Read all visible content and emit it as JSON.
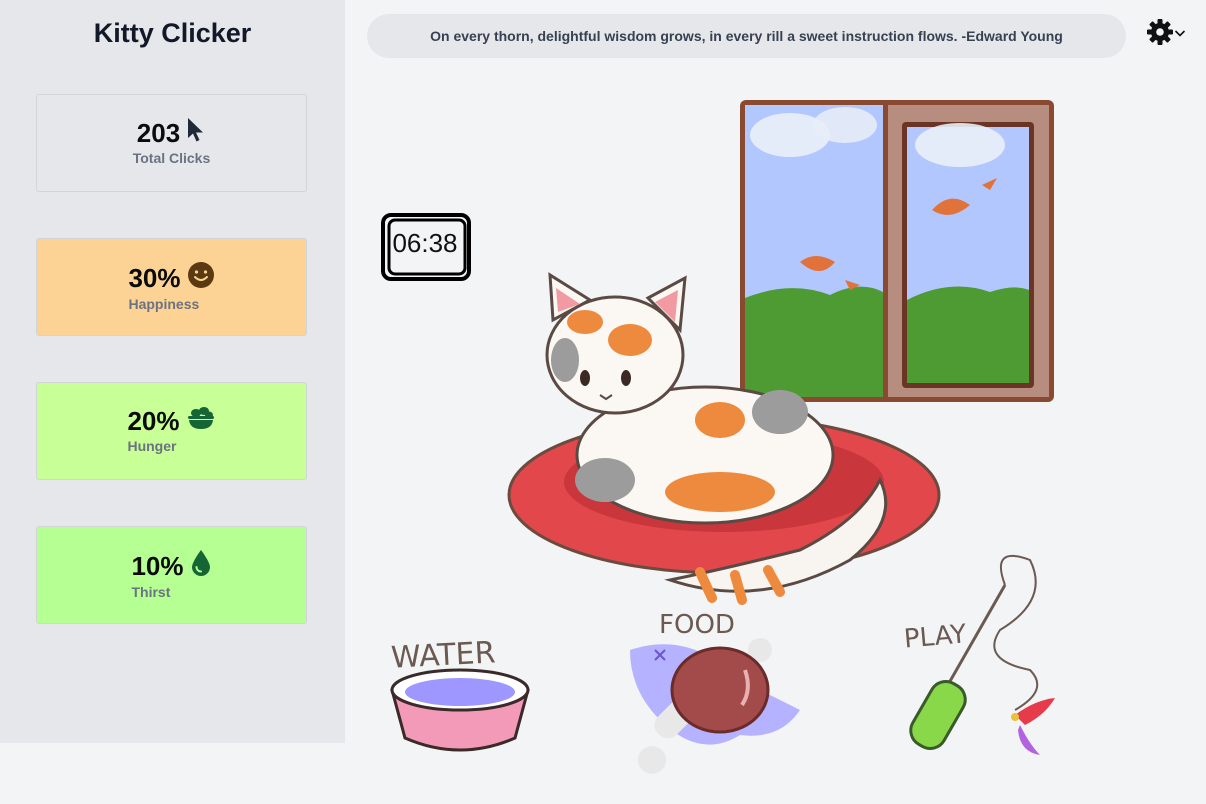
{
  "app": {
    "title": "Kitty Clicker"
  },
  "quote": {
    "text": "On every thorn, delightful wisdom grows, in every rill a sweet instruction flows. -Edward Young"
  },
  "stats": {
    "clicks": {
      "value": "203",
      "label": "Total Clicks",
      "icon": "cursor-icon"
    },
    "happiness": {
      "value": "30%",
      "label": "Happiness",
      "icon": "smile-icon",
      "level": 0.3,
      "color": "#fcd394"
    },
    "hunger": {
      "value": "20%",
      "label": "Hunger",
      "icon": "food-bowl-icon",
      "level": 0.2,
      "color": "#c8ff96"
    },
    "thirst": {
      "value": "10%",
      "label": "Thirst",
      "icon": "water-drop-icon",
      "level": 0.1,
      "color": "#b5ff93"
    }
  },
  "clock": {
    "time": "06:38"
  },
  "actions": {
    "water": {
      "label": "WATER"
    },
    "food": {
      "label": "FOOD"
    },
    "play": {
      "label": "PLAY"
    }
  },
  "settings": {
    "icon": "gear-icon",
    "chevron": "chevron-down-icon"
  }
}
